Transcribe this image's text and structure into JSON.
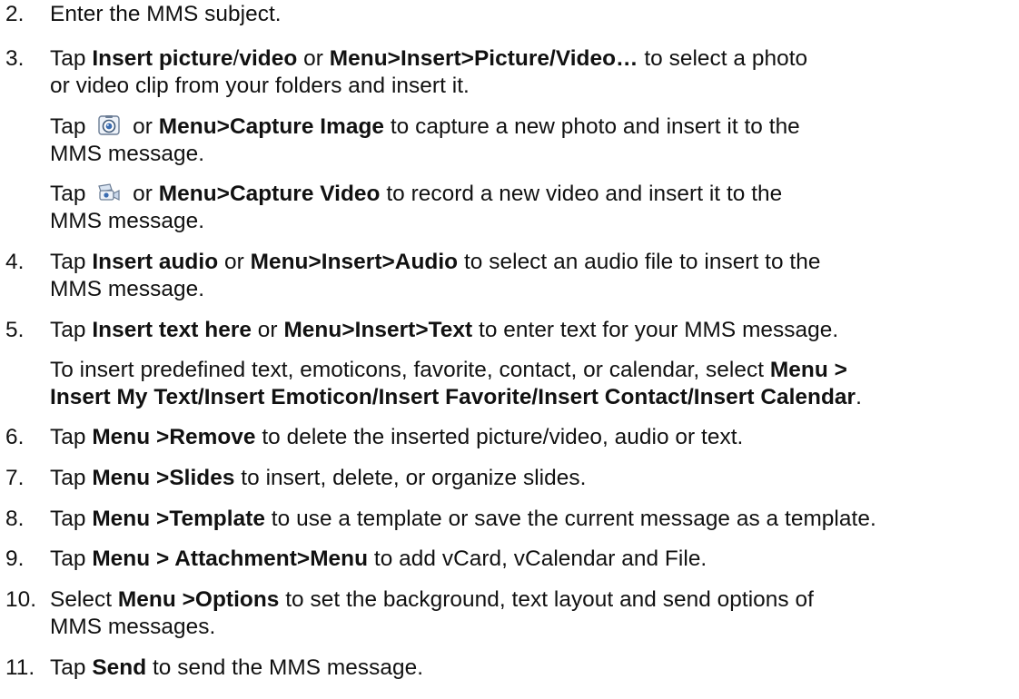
{
  "step2": {
    "number": "2.",
    "text": "Enter the MMS subject."
  },
  "step3": {
    "number": "3.",
    "t1": "Tap ",
    "b1": "Insert picture",
    "t2": "/",
    "b2": "video",
    "t3": " or ",
    "b3": "Menu>Insert>Picture/Video…",
    "t4": " to select a photo",
    "line2": "or video clip from your folders and insert it.",
    "capture_image_pre": "Tap ",
    "capture_image_mid": " or ",
    "capture_image_bold": "Menu>Capture Image",
    "capture_image_post": " to capture a new photo and insert it to the",
    "capture_image_line2": "MMS message.",
    "capture_video_pre": "Tap ",
    "capture_video_mid": " or ",
    "capture_video_bold": "Menu>Capture Video",
    "capture_video_post": " to record a new video and insert it to the",
    "capture_video_line2": "MMS message."
  },
  "step4": {
    "number": "4.",
    "t1": "Tap ",
    "b1": "Insert audio",
    "t2": " or ",
    "b2": "Menu>Insert>Audio",
    "t3": " to select an audio file to insert to the",
    "line2": "MMS message."
  },
  "step5": {
    "number": "5.",
    "t1": "Tap ",
    "b1": "Insert text here",
    "t2": " or ",
    "b2": "Menu>Insert>Text",
    "t3": " to enter text for your MMS message.",
    "note_text": "To insert predefined text, emoticons, favorite, contact, or calendar, select ",
    "note_bold1": "Menu >",
    "note_bold2": "Insert My Text/Insert Emoticon/Insert Favorite/Insert Contact/Insert Calendar",
    "note_end": "."
  },
  "step6": {
    "number": "6.",
    "t1": "Tap ",
    "b1": "Menu >Remove",
    "t2": " to delete the inserted picture/video, audio or text."
  },
  "step7": {
    "number": "7.",
    "t1": "Tap ",
    "b1": "Menu >Slides",
    "t2": " to insert, delete, or organize slides."
  },
  "step8": {
    "number": "8.",
    "t1": "Tap ",
    "b1": "Menu >Template",
    "t2": " to use a template or save the current message as a template."
  },
  "step9": {
    "number": "9.",
    "t1": "Tap ",
    "b1": "Menu > Attachment>Menu",
    "t2": " to add vCard, vCalendar and File."
  },
  "step10": {
    "number": "10.",
    "t1": "Select ",
    "b1": "Menu >Options",
    "t2": " to set the background, text layout and send options of",
    "line2": "MMS messages."
  },
  "step11": {
    "number": "11.",
    "t1": "Tap ",
    "b1": "Send",
    "t2": " to send the MMS message."
  },
  "icons": {
    "capture_image": "camera-icon",
    "capture_video": "video-camera-icon"
  }
}
